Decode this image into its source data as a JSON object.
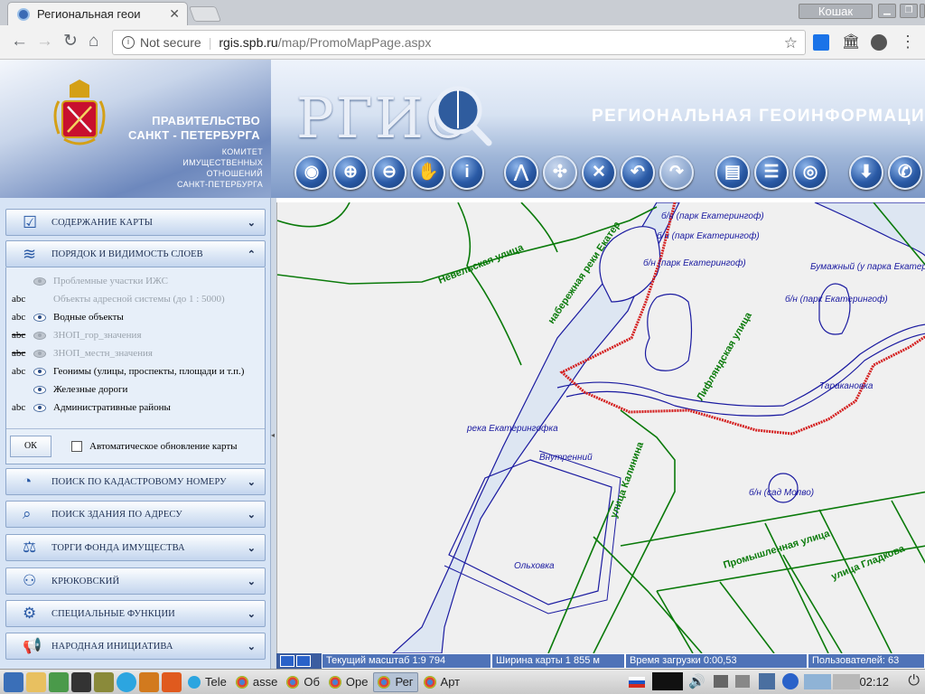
{
  "browser": {
    "tab_title": "Региональная геои",
    "user_name": "Кошак",
    "url_security": "Not secure",
    "url_host": "rgis.spb.ru",
    "url_path": "/map/PromoMapPage.aspx"
  },
  "banner": {
    "gov_line1": "ПРАВИТЕЛЬСТВО",
    "gov_line2": "САНКТ - ПЕТЕРБУРГА",
    "committee_line1": "КОМИТЕТ",
    "committee_line2": "ИМУЩЕСТВЕННЫХ",
    "committee_line3": "ОТНОШЕНИЙ",
    "committee_line4": "САНКТ-ПЕТЕРБУРГА",
    "logo": "РГИС",
    "tagline": "РЕГИОНАЛЬНАЯ  ГЕОИНФОРМАЦИ"
  },
  "sidebar": {
    "map_contents": "Содержание карты",
    "layers_order": "Порядок и видимость слоев",
    "layers": [
      {
        "abc": "",
        "abc_strike": false,
        "visible": false,
        "enabled": false,
        "name": "Проблемные участки ИЖС"
      },
      {
        "abc": "abc",
        "abc_strike": false,
        "visible": false,
        "enabled": false,
        "name": "Объекты адресной системы (до 1 : 5000)"
      },
      {
        "abc": "abc",
        "abc_strike": false,
        "visible": true,
        "enabled": true,
        "name": "Водные объекты"
      },
      {
        "abc": "abc",
        "abc_strike": true,
        "visible": false,
        "enabled": false,
        "name": "ЗНОП_гор_значения"
      },
      {
        "abc": "abc",
        "abc_strike": true,
        "visible": false,
        "enabled": false,
        "name": "ЗНОП_местн_значения"
      },
      {
        "abc": "abc",
        "abc_strike": false,
        "visible": true,
        "enabled": true,
        "name": "Геонимы (улицы, проспекты, площади и т.п.)"
      },
      {
        "abc": "",
        "abc_strike": false,
        "visible": true,
        "enabled": true,
        "name": "Железные дороги"
      },
      {
        "abc": "abc",
        "abc_strike": false,
        "visible": true,
        "enabled": true,
        "name": "Административные районы"
      }
    ],
    "ok_label": "ОК",
    "auto_update_label": "Автоматическое обновление карты",
    "cadastral_search": "Поиск по кадастровому номеру",
    "address_search": "Поиск здания по адресу",
    "property_auction": "Торги фонда имущества",
    "krukovsky": "Крюковский",
    "special_functions": "Специальные функции",
    "public_initiative": "Народная инициатива"
  },
  "map": {
    "labels": [
      "б/н (парк Екатерингоф)",
      "б/н (парк Екатерингоф)",
      "б/н (парк Екатерингоф)",
      "Бумажный (у парка Екатер",
      "б/н (парк Екатерингоф)",
      "Невельская улица",
      "набережная реки Екатер",
      "Лифляндская улица",
      "Таракановка",
      "река Екатерингофка",
      "Внутренний",
      "б/н (сад Молво)",
      "улица Калинина",
      "Промышленная улица",
      "улица Гладкова",
      "Ольховка"
    ]
  },
  "status": {
    "scale": "Текущий масштаб 1:9 794",
    "width": "Ширина карты 1 855 м",
    "load_time": "Время загрузки 0:00,53",
    "users": "Пользователей: 63"
  },
  "taskbar": {
    "items": [
      "Tele",
      "asse",
      "Об",
      "Оре",
      "Рег",
      "Арт"
    ],
    "clock": "02:12"
  }
}
